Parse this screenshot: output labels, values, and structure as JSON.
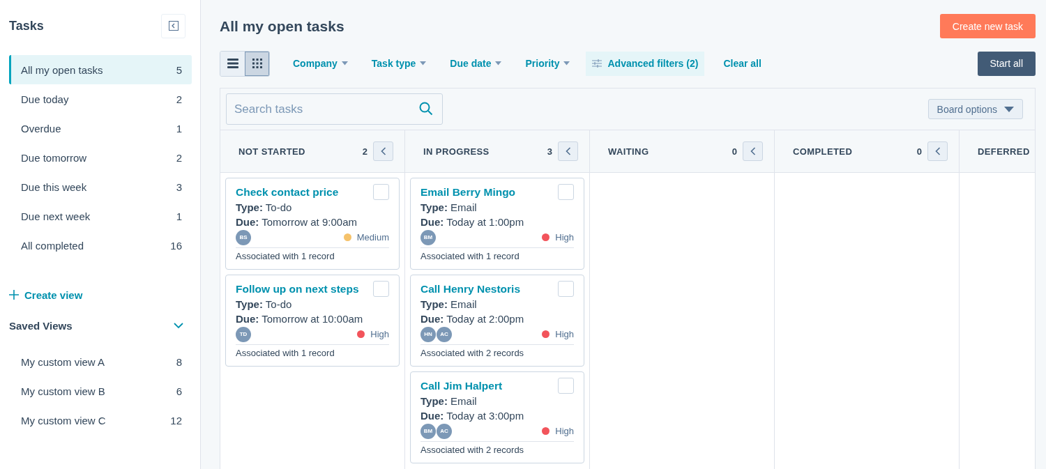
{
  "sidebar": {
    "title": "Tasks",
    "views": [
      {
        "label": "All my open tasks",
        "count": "5",
        "selected": true
      },
      {
        "label": "Due today",
        "count": "2",
        "selected": false
      },
      {
        "label": "Overdue",
        "count": "1",
        "selected": false
      },
      {
        "label": "Due tomorrow",
        "count": "2",
        "selected": false
      },
      {
        "label": "Due this week",
        "count": "3",
        "selected": false
      },
      {
        "label": "Due next week",
        "count": "1",
        "selected": false
      },
      {
        "label": "All completed",
        "count": "16",
        "selected": false
      }
    ],
    "create_view": "Create view",
    "saved_views": {
      "title": "Saved Views",
      "expanded": true,
      "items": [
        {
          "label": "My custom view A",
          "count": "8",
          "selected": false
        },
        {
          "label": "My custom view B",
          "count": "6",
          "selected": false
        },
        {
          "label": "My custom view C",
          "count": "12",
          "selected": false
        }
      ]
    }
  },
  "header": {
    "title": "All my open tasks",
    "create_button": "Create new task"
  },
  "toolbar": {
    "view_toggle": [
      {
        "kind": "list",
        "selected": false
      },
      {
        "kind": "board",
        "selected": true
      }
    ],
    "filters": [
      "Company",
      "Task type",
      "Due date",
      "Priority"
    ],
    "advanced_filters": "Advanced filters (2)",
    "clear_all": "Clear all",
    "start_all": "Start all"
  },
  "board": {
    "search": {
      "placeholder": "Search tasks"
    },
    "board_options": "Board options",
    "columns": [
      {
        "title": "NOT STARTED",
        "count": "2",
        "cards": [
          {
            "title": "Check contact price",
            "type_label": "Type:",
            "type": "To-do",
            "due_label": "Due:",
            "due": "Tomorrow at 9:00am",
            "avatars": [
              "BS"
            ],
            "priority": "Medium",
            "color": "#f5c26b",
            "checked": false,
            "associated": "Associated with 1 record"
          },
          {
            "title": "Follow up on next steps",
            "type_label": "Type:",
            "type": "To-do",
            "due_label": "Due:",
            "due": "Tomorrow at 10:00am",
            "avatars": [
              "TD"
            ],
            "priority": "High",
            "color": "#f2545b",
            "checked": false,
            "associated": "Associated with 1 record"
          }
        ]
      },
      {
        "title": "IN PROGRESS",
        "count": "3",
        "cards": [
          {
            "title": "Email Berry Mingo",
            "type_label": "Type:",
            "type": "Email",
            "due_label": "Due:",
            "due": "Today at 1:00pm",
            "avatars": [
              "BM"
            ],
            "priority": "High",
            "color": "#f2545b",
            "checked": false,
            "associated": "Associated with 1 record"
          },
          {
            "title": "Call Henry Nestoris",
            "type_label": "Type:",
            "type": "Email",
            "due_label": "Due:",
            "due": "Today at 2:00pm",
            "avatars": [
              "HN",
              "AC"
            ],
            "priority": "High",
            "color": "#f2545b",
            "checked": false,
            "associated": "Associated with 2 records"
          },
          {
            "title": "Call Jim Halpert",
            "type_label": "Type:",
            "type": "Email",
            "due_label": "Due:",
            "due": "Today at 3:00pm",
            "avatars": [
              "BM",
              "AC"
            ],
            "priority": "High",
            "color": "#f2545b",
            "checked": false,
            "associated": "Associated with 2 records"
          }
        ]
      },
      {
        "title": "WAITING",
        "count": "0"
      },
      {
        "title": "COMPLETED",
        "count": "0"
      },
      {
        "title": "DEFERRED"
      }
    ]
  }
}
